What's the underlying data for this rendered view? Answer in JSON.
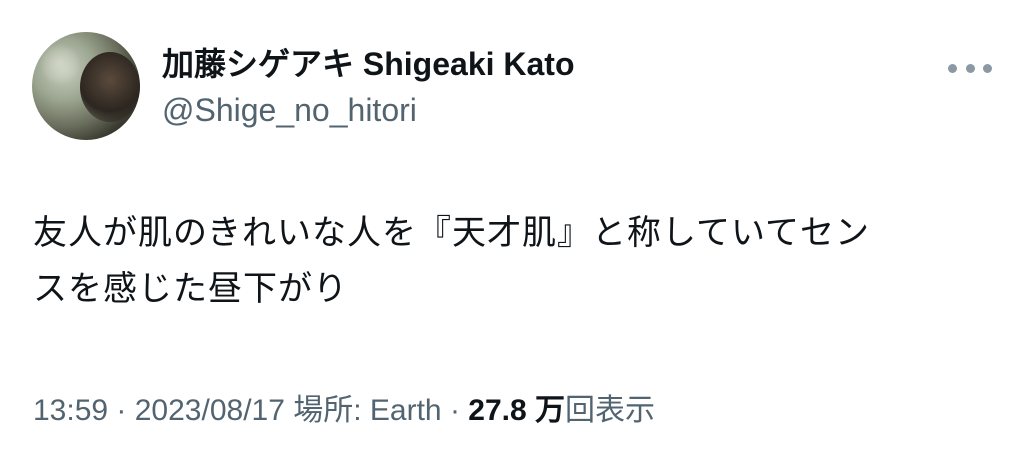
{
  "author": {
    "display_name": "加藤シゲアキ Shigeaki Kato",
    "handle": "@Shige_no_hitori"
  },
  "more_icon": "more-horizontal-icon",
  "tweet": {
    "text_lines": [
      "友人が肌のきれいな人を『天才肌』と称していてセン",
      "スを感じた昼下がり"
    ]
  },
  "meta": {
    "time": "13:59",
    "sep1": " · ",
    "date": "2023/08/17",
    "location": " 場所: Earth",
    "sep2": " · ",
    "views_count": "27.8 万",
    "views_label": "回表示"
  },
  "colors": {
    "text": "#0f1419",
    "secondary": "#536471",
    "icon": "#8b98a5",
    "background": "#ffffff"
  }
}
